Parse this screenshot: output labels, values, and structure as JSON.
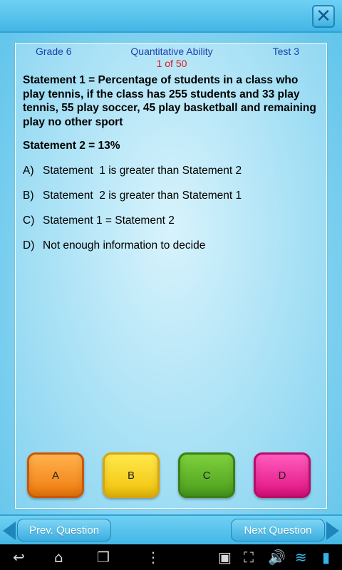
{
  "header": {
    "grade": "Grade 6",
    "subject": "Quantitative Ability",
    "test": "Test 3",
    "counter": "1 of 50"
  },
  "question": {
    "statement1": "Statement 1 = Percentage of students in a class who play tennis, if the class has 255 students and 33 play tennis, 55 play soccer, 45 play basketball and remaining play no other sport",
    "statement2": "Statement 2 = 13%",
    "options": [
      {
        "letter": "A)",
        "text": "Statement  1 is greater than Statement 2"
      },
      {
        "letter": "B)",
        "text": "Statement  2 is greater than Statement 1"
      },
      {
        "letter": "C)",
        "text": "Statement 1 = Statement 2"
      },
      {
        "letter": "D)",
        "text": "Not enough information to decide"
      }
    ]
  },
  "answers": {
    "a": "A",
    "b": "B",
    "c": "C",
    "d": "D"
  },
  "nav": {
    "prev_label": "Prev. Question",
    "next_label": "Next Question"
  },
  "colors": {
    "header_text": "#1a3fb0",
    "counter_text": "#e01a1a",
    "btn_a": "#f07a0c",
    "btn_b": "#f2c20b",
    "btn_c": "#4a9e1c",
    "btn_d": "#e0117f"
  },
  "icons": {
    "close": "close-icon",
    "back": "back-icon",
    "home": "home-icon",
    "recent": "recent-apps-icon",
    "menu": "menu-icon",
    "gallery": "gallery-icon",
    "screenshot": "screenshot-icon",
    "volume": "volume-icon",
    "wifi": "wifi-icon",
    "battery": "battery-icon"
  }
}
